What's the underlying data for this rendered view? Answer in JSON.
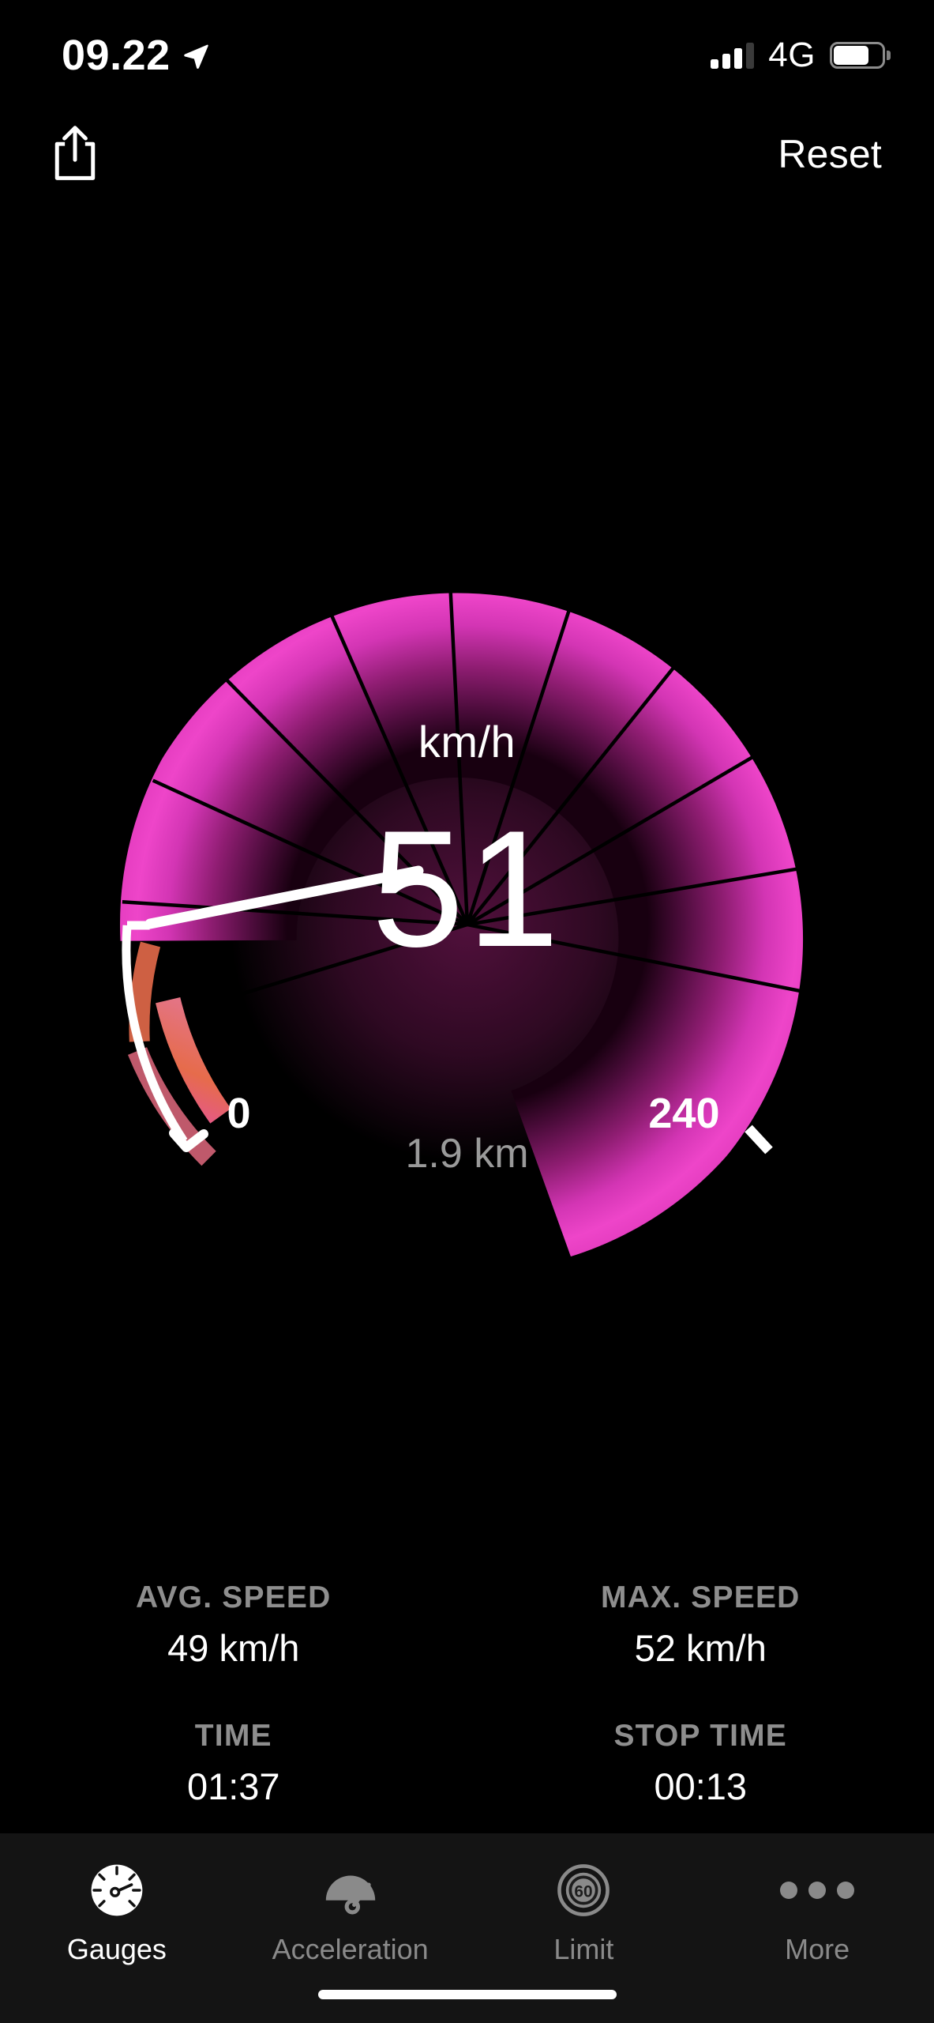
{
  "status_bar": {
    "time": "09.22",
    "location_icon": "location-arrow-icon",
    "signal_bars_filled": 3,
    "signal_bars_total": 4,
    "network": "4G",
    "battery_percent": 75
  },
  "nav_bar": {
    "share_icon": "share-icon",
    "reset_label": "Reset"
  },
  "gauge": {
    "unit": "km/h",
    "speed": "51",
    "min_label": "0",
    "max_label": "240",
    "distance": "1.9 km",
    "accent_color": "#e63ec1",
    "progress_color": "#ffffff",
    "warn_color": "#f2714f"
  },
  "chart_data": {
    "type": "gauge",
    "title": "Speedometer",
    "unit": "km/h",
    "value": 51,
    "min": 0,
    "max": 240,
    "distance_km": 1.9,
    "tick_count": 12,
    "start_angle_deg": 215,
    "end_angle_deg": 325,
    "sweep_deg": 250,
    "ticks": [
      0,
      20,
      40,
      60,
      80,
      100,
      120,
      140,
      160,
      180,
      200,
      220,
      240
    ],
    "tick_labels": [
      "0",
      "240"
    ],
    "series": [
      {
        "name": "current_speed",
        "values": [
          51
        ]
      },
      {
        "name": "avg_speed",
        "values": [
          49
        ]
      },
      {
        "name": "max_speed",
        "values": [
          52
        ]
      }
    ],
    "colors": {
      "track": "#e63ec1",
      "fill": "#ffffff",
      "warn": "#f2714f",
      "background": "#000000"
    },
    "legend": "none",
    "grid": false
  },
  "stats": [
    {
      "label": "AVG. SPEED",
      "value": "49 km/h"
    },
    {
      "label": "MAX. SPEED",
      "value": "52 km/h"
    },
    {
      "label": "TIME",
      "value": "01:37"
    },
    {
      "label": "STOP TIME",
      "value": "00:13"
    }
  ],
  "tabs": [
    {
      "label": "Gauges",
      "icon": "speedometer-icon",
      "active": true
    },
    {
      "label": "Acceleration",
      "icon": "acceleration-gauge-icon",
      "active": false
    },
    {
      "label": "Limit",
      "icon": "speed-limit-sign-icon",
      "limit_value": "60",
      "active": false
    },
    {
      "label": "More",
      "icon": "ellipsis-icon",
      "active": false
    }
  ]
}
